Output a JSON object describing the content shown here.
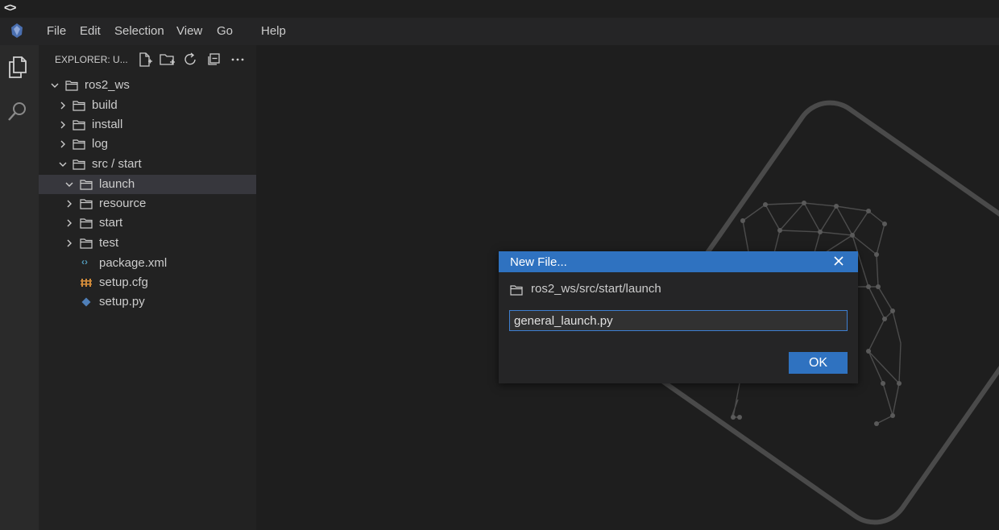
{
  "titlebar": {
    "code_icon": "<>"
  },
  "menu": {
    "items": [
      "File",
      "Edit",
      "Selection",
      "View",
      "Go",
      "Help"
    ]
  },
  "explorer": {
    "title": "EXPLORER: U...",
    "tree": [
      {
        "label": "ros2_ws",
        "type": "folder",
        "expanded": true
      },
      {
        "label": "build",
        "type": "folder",
        "expanded": false
      },
      {
        "label": "install",
        "type": "folder",
        "expanded": false
      },
      {
        "label": "log",
        "type": "folder",
        "expanded": false
      },
      {
        "label": "src / start",
        "type": "folder",
        "expanded": true
      },
      {
        "label": "launch",
        "type": "folder",
        "expanded": true,
        "selected": true
      },
      {
        "label": "resource",
        "type": "folder",
        "expanded": false
      },
      {
        "label": "start",
        "type": "folder",
        "expanded": false
      },
      {
        "label": "test",
        "type": "folder",
        "expanded": false
      },
      {
        "label": "package.xml",
        "type": "file",
        "icon": "xml-icon"
      },
      {
        "label": "setup.cfg",
        "type": "file",
        "icon": "config-icon"
      },
      {
        "label": "setup.py",
        "type": "file",
        "icon": "python-icon"
      }
    ]
  },
  "dialog": {
    "title": "New File...",
    "path": "ros2_ws/src/start/launch",
    "filename": "general_launch.py",
    "ok_label": "OK"
  },
  "colors": {
    "accent": "#2f72c0",
    "background": "#1e1e1e",
    "sidebar": "#222222",
    "selection": "#37373d"
  }
}
